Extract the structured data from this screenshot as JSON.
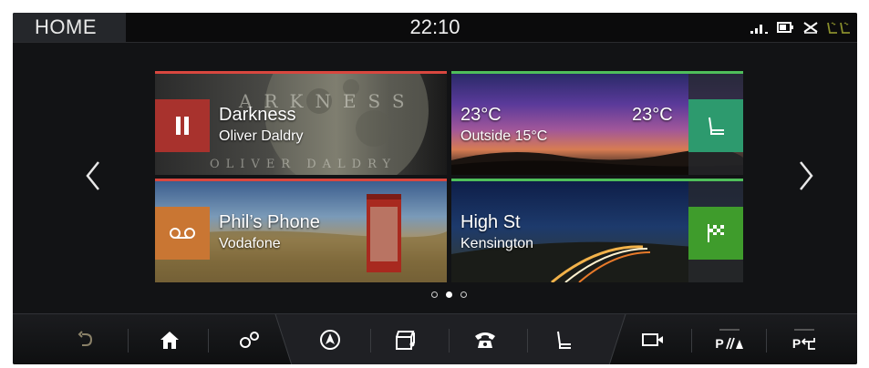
{
  "status_bar": {
    "home_label": "HOME",
    "time": "22:10",
    "icons": [
      "signal-icon",
      "battery-icon",
      "fan-icon",
      "seat-heat-icon"
    ]
  },
  "tiles": [
    {
      "id": "media",
      "title": "Darkness",
      "subtitle": "Oliver Daldry",
      "art_text_top": "ARKNESS",
      "art_text_bottom": "OLIVER DALDRY",
      "button_icon": "pause-icon",
      "accent": "#d9473f",
      "button_color": "#a8322d"
    },
    {
      "id": "climate",
      "title": "23°C",
      "title_right": "23°C",
      "subtitle": "Outside 15°C",
      "button_icon": "seat-icon",
      "accent": "#4fbf5b",
      "button_color": "#2d9a6e"
    },
    {
      "id": "phone",
      "title": "Phil’s Phone",
      "subtitle": "Vodafone",
      "button_icon": "voicemail-icon",
      "accent": "#d9473f",
      "button_color": "#c97633"
    },
    {
      "id": "navigation",
      "title": "High St",
      "subtitle": "Kensington",
      "button_icon": "checkered-flag-icon",
      "accent": "#4fbf5b",
      "button_color": "#3f9c2c"
    }
  ],
  "pagination": {
    "pages": 3,
    "active": 1
  },
  "dock": {
    "items": [
      "back-icon",
      "home-icon",
      "settings-icon",
      "navigation-icon",
      "media-icon",
      "phone-icon",
      "seat-icon",
      "camera-icon",
      "parking-sensor-icon",
      "park-assist-icon"
    ],
    "park_label": "P",
    "park_assist_label": "P"
  },
  "colors": {
    "background": "#121315",
    "accent_red": "#d9473f",
    "accent_green": "#4fbf5b"
  }
}
